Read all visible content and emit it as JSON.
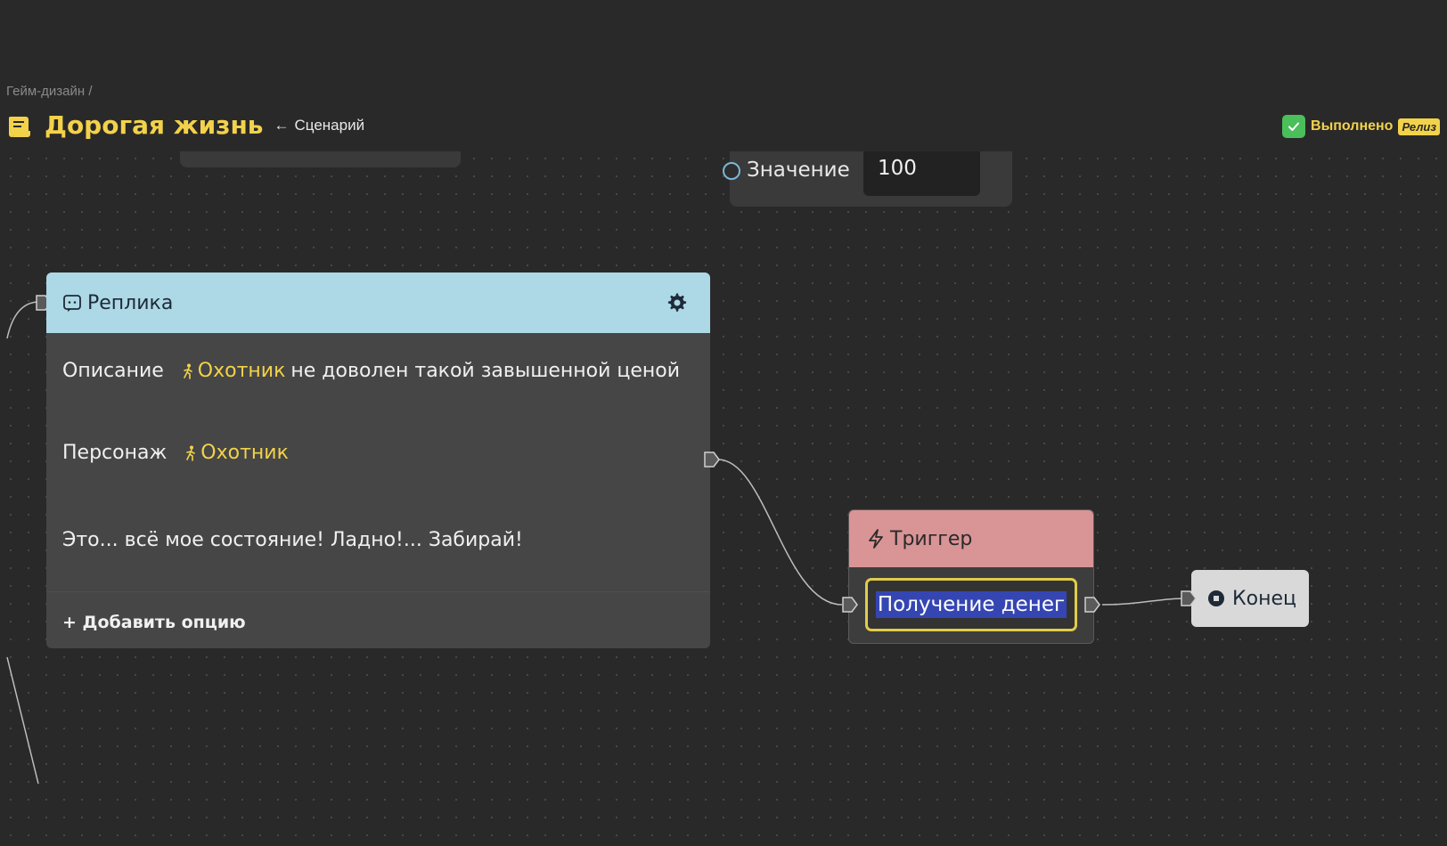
{
  "header": {
    "breadcrumb": "Гейм-дизайн /",
    "title": "Дорогая жизнь",
    "back_link": "Сценарий",
    "status_label": "Выполнено",
    "status_badge": "Релиз",
    "colors": {
      "title": "#f2d24a",
      "status_check": "#4bbf5a"
    }
  },
  "value_node": {
    "label": "Значение",
    "value": "100"
  },
  "reply_node": {
    "title": "Реплика",
    "header_color": "#add8e6",
    "description_label": "Описание",
    "description_character": "Охотник",
    "description_rest": "не доволен такой завышенной ценой",
    "character_label": "Персонаж",
    "character_value": "Охотник",
    "text": "Это... всё мое состояние! Ладно!... Забирай!",
    "add_option": "+ Добавить опцию"
  },
  "trigger_node": {
    "title": "Триггер",
    "header_color": "#d99496",
    "value": "Получение денег"
  },
  "end_node": {
    "label": "Конец"
  }
}
